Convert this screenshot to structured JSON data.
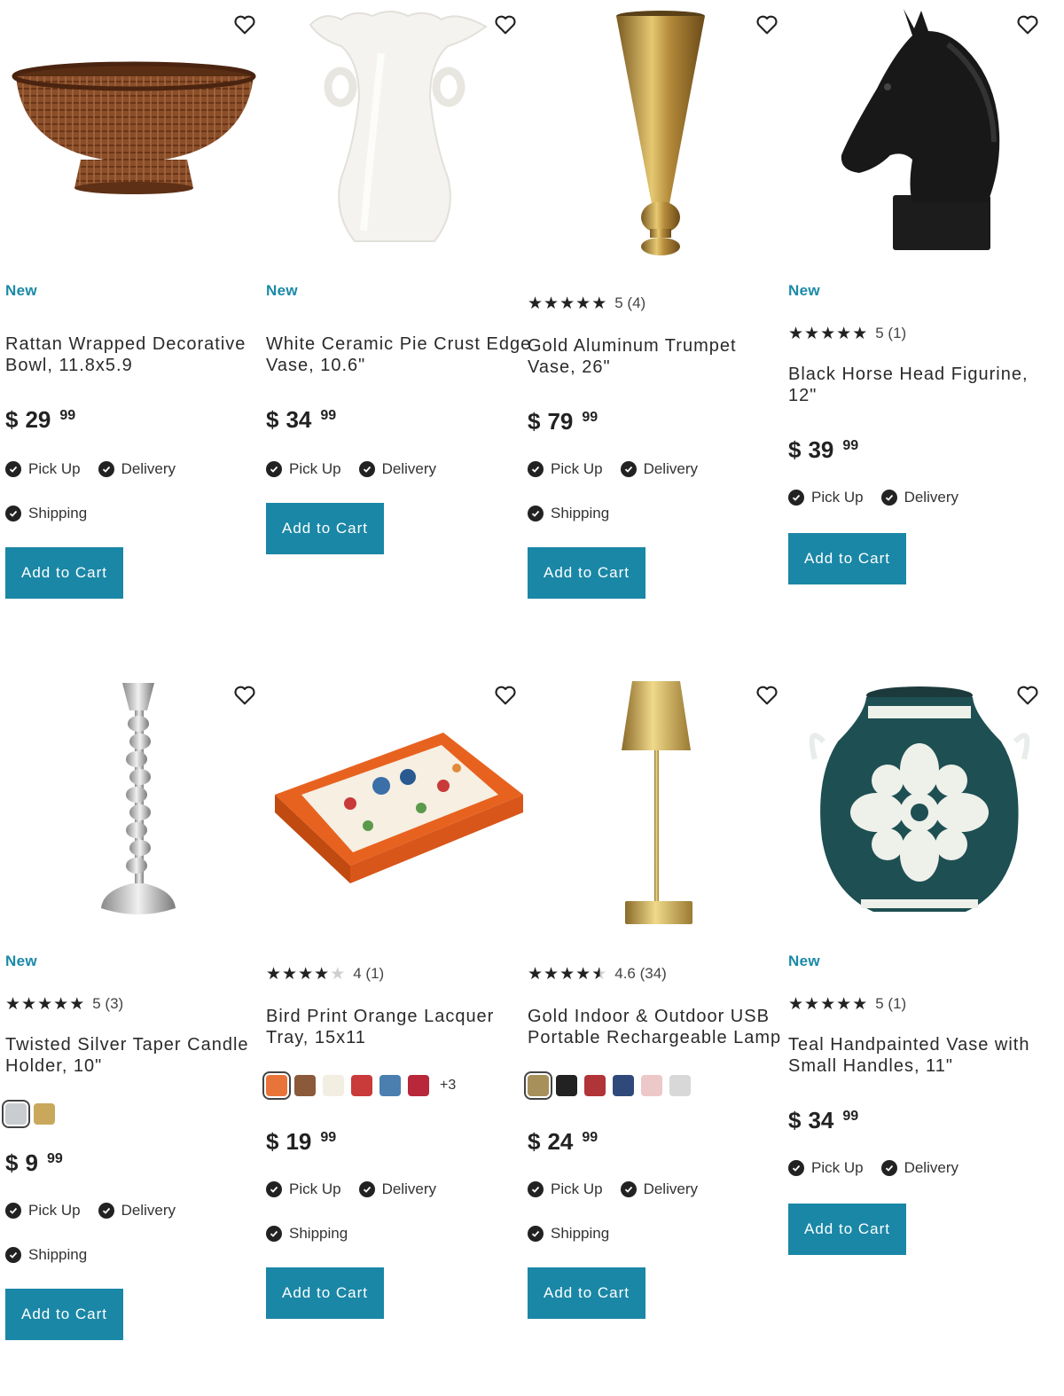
{
  "products": [
    {
      "badge": "New",
      "rating": null,
      "title": [
        "Rattan Wrapped Decorative",
        "Bowl, 11.8x5.9"
      ],
      "price": {
        "dollar": "$",
        "whole": "29",
        "cents": "99"
      },
      "fulfillment": [
        "Pick Up",
        "Delivery",
        "Shipping"
      ],
      "button": "Add to Cart"
    },
    {
      "badge": "New",
      "rating": null,
      "title": [
        "White Ceramic Pie Crust Edge",
        "Vase, 10.6\""
      ],
      "price": {
        "dollar": "$",
        "whole": "34",
        "cents": "99"
      },
      "fulfillment": [
        "Pick Up",
        "Delivery"
      ],
      "button": "Add to Cart"
    },
    {
      "badge": "",
      "rating": {
        "stars": 5,
        "text": "5 (4)"
      },
      "title": [
        "Gold Aluminum Trumpet",
        "Vase, 26\""
      ],
      "price": {
        "dollar": "$",
        "whole": "79",
        "cents": "99"
      },
      "fulfillment": [
        "Pick Up",
        "Delivery",
        "Shipping"
      ],
      "button": "Add to Cart"
    },
    {
      "badge": "New",
      "rating": {
        "stars": 5,
        "text": "5 (1)"
      },
      "title": [
        "Black Horse Head Figurine,",
        "12\""
      ],
      "price": {
        "dollar": "$",
        "whole": "39",
        "cents": "99"
      },
      "fulfillment": [
        "Pick Up",
        "Delivery"
      ],
      "button": "Add to Cart"
    },
    {
      "badge": "New",
      "rating": {
        "stars": 5,
        "text": "5 (3)"
      },
      "title": [
        "Twisted Silver Taper Candle",
        "Holder, 10\""
      ],
      "swatches": [
        "#c9cdd0",
        "#c9a85c"
      ],
      "price": {
        "dollar": "$",
        "whole": "9",
        "cents": "99"
      },
      "fulfillment": [
        "Pick Up",
        "Delivery",
        "Shipping"
      ],
      "button": "Add to Cart"
    },
    {
      "badge": "",
      "rating": {
        "stars": 4,
        "text": "4 (1)"
      },
      "title": [
        "Bird Print Orange Lacquer",
        "Tray, 15x11"
      ],
      "swatches": [
        "#e8743a",
        "#8a5a3a",
        "#f2eee2",
        "#c93a3a",
        "#4a7fb0",
        "#b8283a"
      ],
      "swatch_more": "+3",
      "price": {
        "dollar": "$",
        "whole": "19",
        "cents": "99"
      },
      "fulfillment": [
        "Pick Up",
        "Delivery",
        "Shipping"
      ],
      "button": "Add to Cart"
    },
    {
      "badge": "",
      "rating": {
        "stars": 4.6,
        "text": "4.6 (34)"
      },
      "title": [
        "Gold Indoor & Outdoor USB",
        "Portable Rechargeable Lamp"
      ],
      "swatches": [
        "#a8905a",
        "#222222",
        "#b03438",
        "#2f4a7a",
        "#edc8c8",
        "#d8d8d8"
      ],
      "price": {
        "dollar": "$",
        "whole": "24",
        "cents": "99"
      },
      "fulfillment": [
        "Pick Up",
        "Delivery",
        "Shipping"
      ],
      "button": "Add to Cart"
    },
    {
      "badge": "New",
      "rating": {
        "stars": 5,
        "text": "5 (1)"
      },
      "title": [
        "Teal Handpainted Vase with",
        "Small Handles, 11\""
      ],
      "price": {
        "dollar": "$",
        "whole": "34",
        "cents": "99"
      },
      "fulfillment": [
        "Pick Up",
        "Delivery"
      ],
      "button": "Add to Cart"
    }
  ],
  "icons": {
    "wishlist": "heart-outline-icon",
    "fulfillment": "check-circle-icon",
    "rating": "star-icon"
  },
  "colors": {
    "accent": "#1a87a6",
    "badge": "#1a8aa8"
  }
}
